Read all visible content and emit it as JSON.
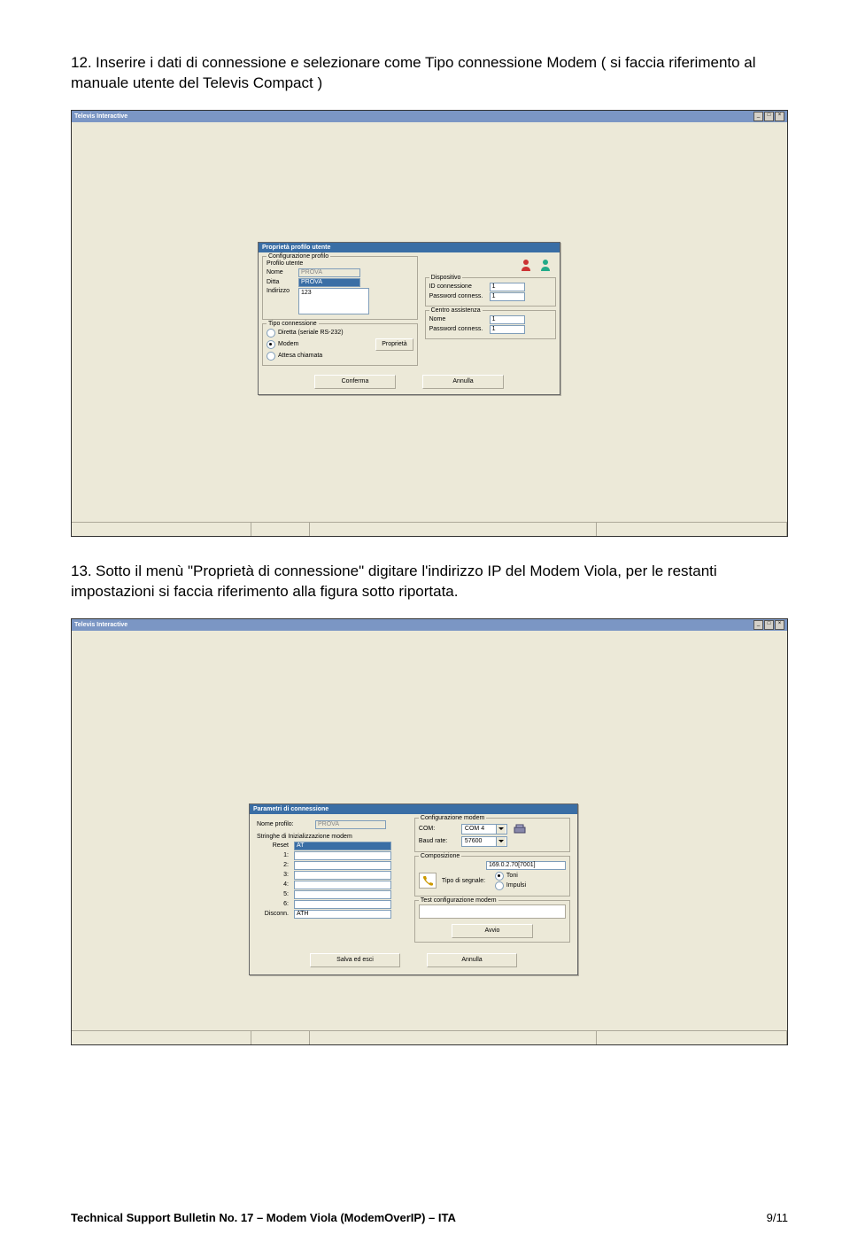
{
  "steps": {
    "s12": {
      "num": "12.",
      "text": "Inserire i dati di connessione e selezionare come Tipo connessione Modem ( si faccia riferimento al manuale utente del Televis Compact )"
    },
    "s13": {
      "num": "13.",
      "text": "Sotto il menù \"Proprietà di connessione\" digitare l'indirizzo IP del Modem Viola, per le restanti impostazioni si faccia riferimento alla figura sotto riportata."
    }
  },
  "app_title": "Televis Interactive",
  "dialog1": {
    "title": "Proprietà profilo utente",
    "group_conf": "Configurazione profilo",
    "group_profile": "Profilo utente",
    "nome_lbl": "Nome",
    "nome_val": "PROVA",
    "ditta_lbl": "Ditta",
    "ditta_val": "PROVA",
    "indirizzo_lbl": "Indirizzo",
    "indirizzo_val": "123",
    "group_dispositivo": "Dispositivo",
    "id_conn_lbl": "ID connessione",
    "id_conn_val": "1",
    "pwd_conn_lbl": "Password conness.",
    "pwd_conn_val": "1",
    "group_tipo": "Tipo connessione",
    "tipo_diretta": "Diretta (seriale RS-232)",
    "tipo_modem": "Modem",
    "tipo_attesa": "Attesa chiamata",
    "btn_proprieta": "Proprietà",
    "group_centro": "Centro assistenza",
    "centro_nome_lbl": "Nome",
    "centro_nome_val": "1",
    "centro_pwd_lbl": "Password conness.",
    "centro_pwd_val": "1",
    "btn_conferma": "Conferma",
    "btn_annulla": "Annulla"
  },
  "dialog2": {
    "title": "Parametri di connessione",
    "nome_profilo_lbl": "Nome profilo:",
    "nome_profilo_val": "PROVA",
    "stringhe_lbl": "Stringhe di Inizializzazione modem",
    "reset_lbl": "Reset",
    "reset_val": "AT",
    "r1": "1:",
    "r2": "2:",
    "r3": "3:",
    "r4": "4:",
    "r5": "5:",
    "r6": "6:",
    "disconn_lbl": "Disconn.",
    "disconn_val": "ATH",
    "group_confmodem": "Configurazione modem",
    "com_lbl": "COM:",
    "com_val": "COM 4",
    "baud_lbl": "Baud rate:",
    "baud_val": "57600",
    "group_comp": "Composizione",
    "comp_val": "169.0.2.70[7001]",
    "tipo_segnale_lbl": "Tipo di segnale:",
    "toni": "Toni",
    "impulsi": "Impulsi",
    "group_test": "Test configurazione modem",
    "btn_avvio": "Avvio",
    "btn_salva": "Salva ed esci",
    "btn_annulla": "Annulla"
  },
  "footer": {
    "left": "Technical Support Bulletin  No. 17 – Modem Viola (ModemOverIP)  – ITA",
    "right": "9/11"
  }
}
